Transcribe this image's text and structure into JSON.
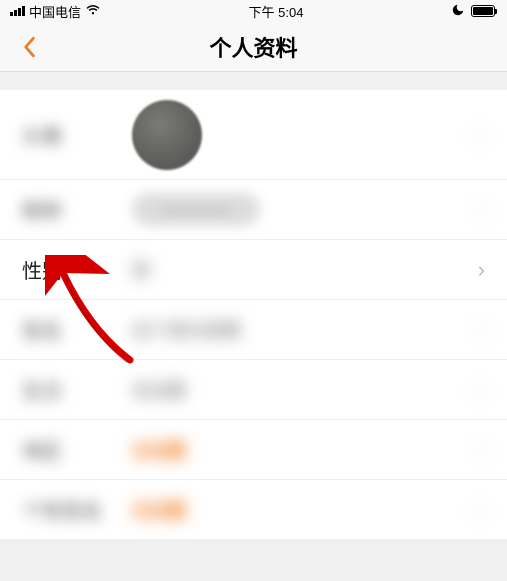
{
  "status": {
    "carrier": "中国电信",
    "time": "下午 5:04"
  },
  "nav": {
    "title": "个人资料"
  },
  "rows": {
    "avatar": {
      "label": "头像"
    },
    "nickname": {
      "label": "昵称",
      "value": "————"
    },
    "gender": {
      "label": "性别",
      "value": "男"
    },
    "r4": {
      "label": "签名",
      "value": "这个家伙很懒"
    },
    "r5": {
      "label": "生日",
      "value": "未设置"
    },
    "r6": {
      "label": "地区",
      "value": "去设置"
    },
    "r7": {
      "label": "个性签名",
      "value": "去设置"
    }
  }
}
